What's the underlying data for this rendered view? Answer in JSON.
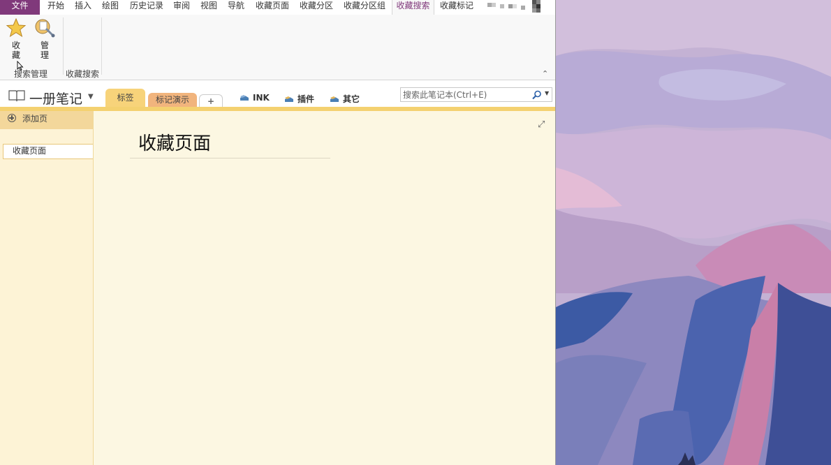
{
  "ribbon_tabs": [
    {
      "label": "文件"
    },
    {
      "label": "开始"
    },
    {
      "label": "插入"
    },
    {
      "label": "绘图"
    },
    {
      "label": "历史记录"
    },
    {
      "label": "审阅"
    },
    {
      "label": "视图"
    },
    {
      "label": "导航"
    },
    {
      "label": "收藏页面"
    },
    {
      "label": "收藏分区"
    },
    {
      "label": "收藏分区组"
    },
    {
      "label": "收藏搜索"
    },
    {
      "label": "收藏标记"
    }
  ],
  "ribbon": {
    "favorite_label": "收藏",
    "manage_label": "管理",
    "group1_label": "搜索管理",
    "group2_label": "收藏搜索"
  },
  "notebook": {
    "name": "一册笔记",
    "sections": [
      {
        "label": "标签"
      },
      {
        "label": "标记演示"
      }
    ],
    "add_section": "+",
    "links": [
      {
        "label": "INK"
      },
      {
        "label": "插件"
      },
      {
        "label": "其它"
      }
    ],
    "search_placeholder": "搜索此笔记本(Ctrl+E)"
  },
  "pages": {
    "add_page": "添加页",
    "items": [
      {
        "label": "收藏页面"
      }
    ]
  },
  "page": {
    "title": "收藏页面"
  },
  "colors": {
    "accent": "#80397b",
    "section_tab_1": "#f7d37a",
    "section_tab_2": "#f1b47d",
    "canvas": "#fcf7e2"
  }
}
